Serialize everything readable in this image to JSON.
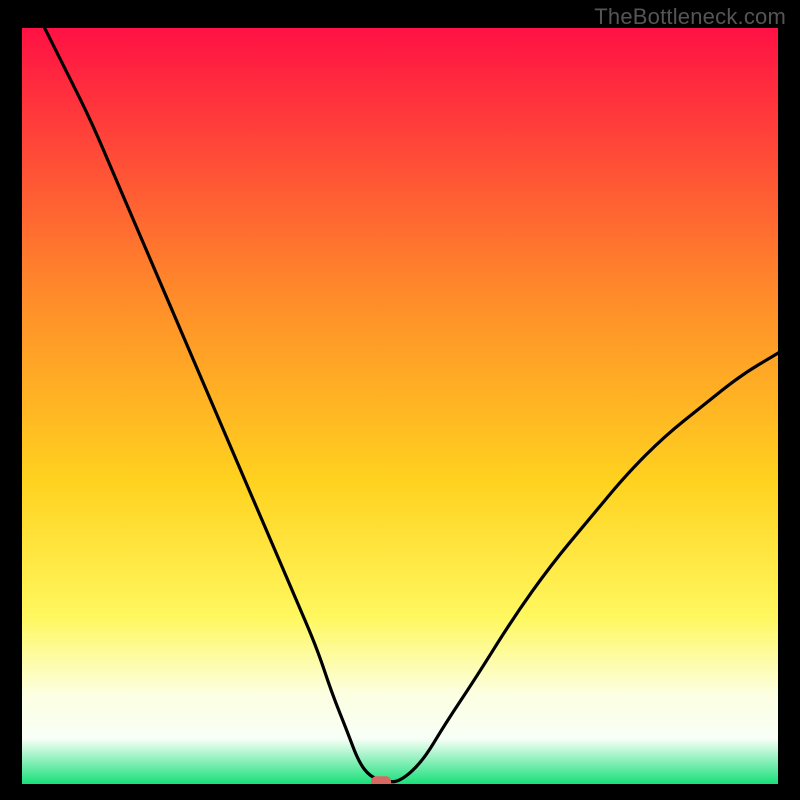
{
  "watermark": "TheBottleneck.com",
  "chart_data": {
    "type": "line",
    "title": "",
    "xlabel": "",
    "ylabel": "",
    "xlim": [
      0,
      100
    ],
    "ylim": [
      0,
      100
    ],
    "grid": false,
    "legend": false,
    "curve": {
      "name": "bottleneck-curve",
      "x": [
        3,
        6,
        9,
        12,
        15,
        18,
        21,
        24,
        27,
        30,
        33,
        36,
        39,
        41,
        43,
        44.5,
        46,
        48,
        50,
        53,
        56,
        60,
        65,
        70,
        75,
        80,
        85,
        90,
        95,
        100
      ],
      "y": [
        100,
        94,
        88,
        81,
        74,
        67,
        60,
        53,
        46,
        39,
        32,
        25,
        18,
        12,
        7,
        3,
        1,
        0.3,
        0.3,
        3,
        8,
        14,
        22,
        29,
        35,
        41,
        46,
        50,
        54,
        57
      ]
    },
    "marker": {
      "x": 47.5,
      "y": 0.3,
      "color": "#d66a63"
    },
    "gradient_stops": [
      {
        "offset": 0,
        "color": "#ff1144"
      },
      {
        "offset": 35,
        "color": "#ff8a2a"
      },
      {
        "offset": 60,
        "color": "#ffd21f"
      },
      {
        "offset": 78,
        "color": "#fff85f"
      },
      {
        "offset": 88,
        "color": "#fcffe0"
      },
      {
        "offset": 94,
        "color": "#f8fff7"
      },
      {
        "offset": 100,
        "color": "#18e07a"
      }
    ]
  }
}
